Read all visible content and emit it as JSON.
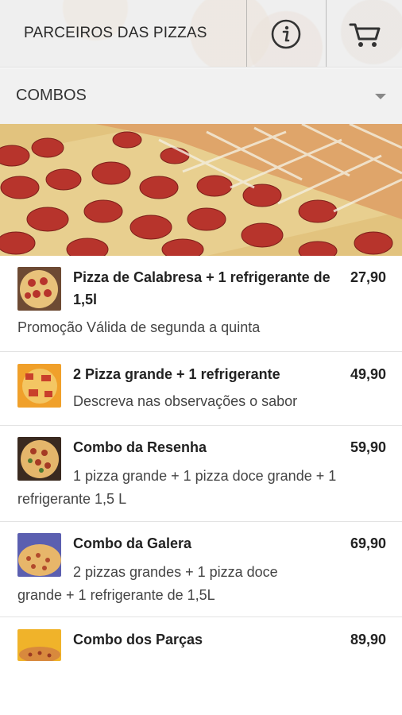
{
  "header": {
    "title": "PARCEIROS DAS PIZZAS",
    "info_icon": "info-circle-icon",
    "cart_icon": "shopping-cart-icon"
  },
  "category": {
    "label": "COMBOS",
    "dropdown_icon": "caret-down-icon"
  },
  "colors": {
    "header_bg": "#ececec",
    "category_bg": "#f1f1f1",
    "text": "#222222",
    "divider": "#e3e3e3"
  },
  "products": [
    {
      "name": "Pizza de Calabresa + 1 refrigerante de 1,5l",
      "price": "27,90",
      "description": "Promoção Válida de segunda a quinta"
    },
    {
      "name": "2 Pizza grande + 1 refrigerante",
      "price": "49,90",
      "description": "Descreva nas observações o sabor"
    },
    {
      "name": "Combo da Resenha",
      "price": "59,90",
      "description": "1 pizza grande + 1 pizza doce grande + 1 refrigerante 1,5 L"
    },
    {
      "name": "Combo da Galera",
      "price": "69,90",
      "description": "2 pizzas grandes + 1 pizza doce grande + 1 refrigerante de 1,5L"
    },
    {
      "name": "Combo dos Parças",
      "price": "89,90"
    }
  ]
}
